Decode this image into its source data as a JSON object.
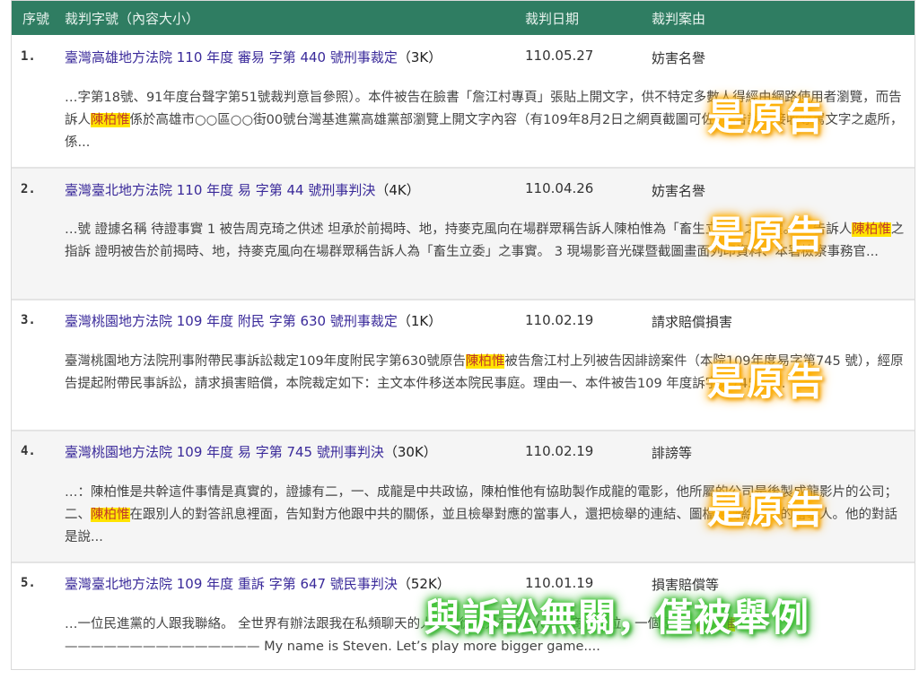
{
  "header": {
    "col_index": "序號",
    "col_case": "裁判字號（內容大小）",
    "col_date": "裁判日期",
    "col_cause": "裁判案由"
  },
  "rows": [
    {
      "index": "1.",
      "title": "臺灣高雄地方法院 110 年度 審易 字第 440 號刑事裁定",
      "size": "（3K）",
      "date": "110.05.27",
      "cause": "妨害名譽",
      "snippet_pre": "…字第18號、91年度台聲字第51號裁判意旨參照）。本件被告在臉書「詹江村專頁」張貼上開文字，供不特定多數人得經由網路使用者瀏覽，而告訴人",
      "name": "陳柏惟",
      "snippet_post": "係於高雄市○○區○○街00號台灣基進黨高雄黨部瀏覽上開文字內容（有109年8月2日之網頁截圖可佐），告訴人接收辱罵文字之處所，係..."
    },
    {
      "index": "2.",
      "title": "臺灣臺北地方法院 110 年度 易 字第 44 號刑事判決",
      "size": "（4K）",
      "date": "110.04.26",
      "cause": "妨害名譽",
      "snippet_pre": "…號 證據名稱 待證事實 1 被告周克琦之供述 坦承於前揭時、地，持麥克風向在場群眾稱告訴人陳柏惟為「畜生立委」之事實。 2 告訴人",
      "name": "陳柏惟",
      "snippet_post": "之指訴 證明被告於前揭時、地，持麥克風向在場群眾稱告訴人為「畜生立委」之事實。 3 現場影音光碟暨截圖畫面列印資料、本署檢察事務官..."
    },
    {
      "index": "3.",
      "title": "臺灣桃園地方法院 109 年度 附民 字第 630 號刑事裁定",
      "size": "（1K）",
      "date": "110.02.19",
      "cause": "請求賠償損害",
      "snippet_pre": "臺灣桃園地方法院刑事附帶民事訴訟裁定109年度附民字第630號原告",
      "name": "陳柏惟",
      "snippet_post": "被告詹江村上列被告因誹謗案件（本院109年度易字第745 號），經原告提起附帶民事訴訟，請求損害賠償，本院裁定如下：主文本件移送本院民事庭。理由一、本件被告109 年度訴字第745 號..."
    },
    {
      "index": "4.",
      "title": "臺灣桃園地方法院 109 年度 易 字第 745 號刑事判決",
      "size": "（30K）",
      "date": "110.02.19",
      "cause": "誹謗等",
      "snippet_pre": "…：陳柏惟是共幹這件事情是真實的，證據有二，一、成龍是中共政協，陳柏惟他有協助製作成龍的電影，他所屬的公司是後製成龍影片的公司；二、",
      "name": "陳柏惟",
      "snippet_post": "在跟別人的對答訊息裡面，告知對方他跟中共的關係，並且檢舉對應的當事人，還把檢舉的連結、圖檔也傳給對應的當事人。他的對話是說..."
    },
    {
      "index": "5.",
      "title": "臺灣臺北地方法院 109 年度 重訴 字第 647 號民事判決",
      "size": "（52K）",
      "date": "110.01.19",
      "cause": "損害賠償等",
      "snippet_pre": "…一位民進黨的人跟我聯絡。 全世界有辦法跟我在私頻聊天的人，我從來只有Steven小商人一位，一個是3Q ",
      "name": "陳柏惟",
      "snippet_post": " ——————————————— My name is Steven. Let’s play more bigger game...."
    }
  ],
  "overlays": {
    "plaintiff_label": "是原告",
    "unrelated_label": "與訴訟無關，僅被舉例"
  },
  "colors": {
    "header_bg": "#2f7d62",
    "link": "#3a2a9a",
    "highlight": "#ffe400",
    "stamp_glow_orange": "#ffb400",
    "stamp_glow_green": "#46c93a"
  }
}
